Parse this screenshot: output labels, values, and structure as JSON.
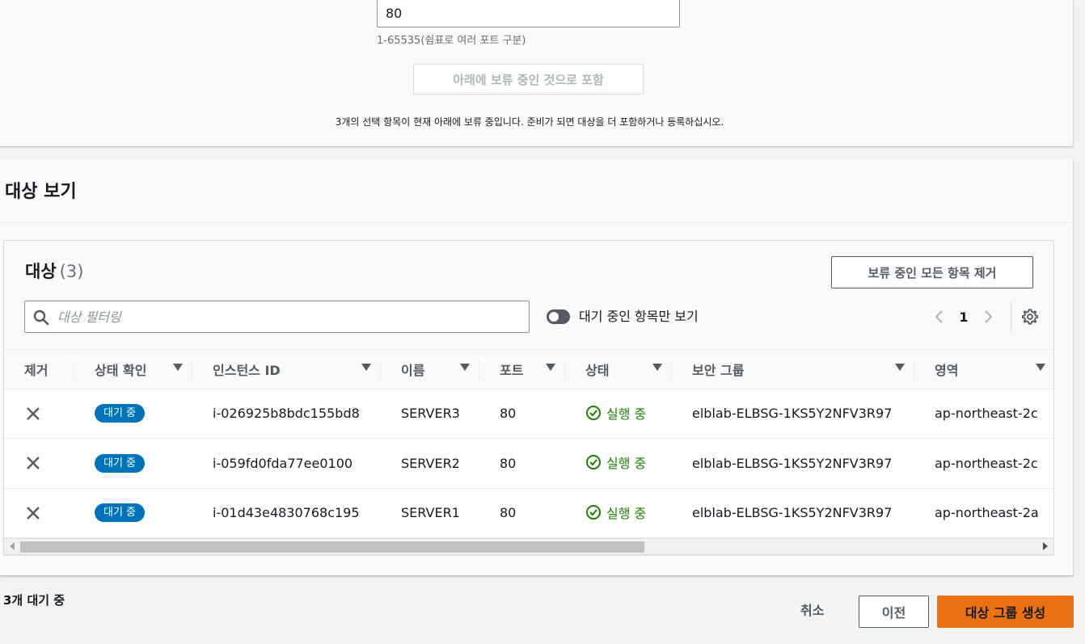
{
  "port_section": {
    "port_value": "80",
    "port_hint": "1-65535(쉼표로 여러 포트 구분)",
    "include_button": "아래에 보류 중인 것으로 포함",
    "pending_note": "3개의 선택 항목이 현재 아래에 보류 중입니다. 준비가 되면 대상을 더 포함하거나 등록하십시오."
  },
  "view_section": {
    "title": "대상 보기"
  },
  "targets": {
    "title": "대상",
    "count": "(3)",
    "remove_all_button": "보류 중인 모든 항목 제거",
    "filter_placeholder": "대상 필터링",
    "toggle_label": "대기 중인 항목만 보기",
    "page": "1",
    "columns": [
      "제거",
      "상태 확인",
      "인스턴스 ID",
      "이름",
      "포트",
      "상태",
      "보안 그룹",
      "영역"
    ],
    "rows": [
      {
        "health": "대기 중",
        "instance_id": "i-026925b8bdc155bd8",
        "name": "SERVER3",
        "port": "80",
        "state": "실행 중",
        "security_group": "elblab-ELBSG-1KS5Y2NFV3R97",
        "zone": "ap-northeast-2c"
      },
      {
        "health": "대기 중",
        "instance_id": "i-059fd0fda77ee0100",
        "name": "SERVER2",
        "port": "80",
        "state": "실행 중",
        "security_group": "elblab-ELBSG-1KS5Y2NFV3R97",
        "zone": "ap-northeast-2c"
      },
      {
        "health": "대기 중",
        "instance_id": "i-01d43e4830768c195",
        "name": "SERVER1",
        "port": "80",
        "state": "실행 중",
        "security_group": "elblab-ELBSG-1KS5Y2NFV3R97",
        "zone": "ap-northeast-2a"
      }
    ]
  },
  "footer": {
    "pending_count": "3개 대기 중",
    "cancel": "취소",
    "previous": "이전",
    "create": "대상 그룹 생성"
  },
  "colors": {
    "accent_orange": "#ec7211",
    "badge_blue": "#0073bb",
    "running_green": "#1d8102"
  }
}
